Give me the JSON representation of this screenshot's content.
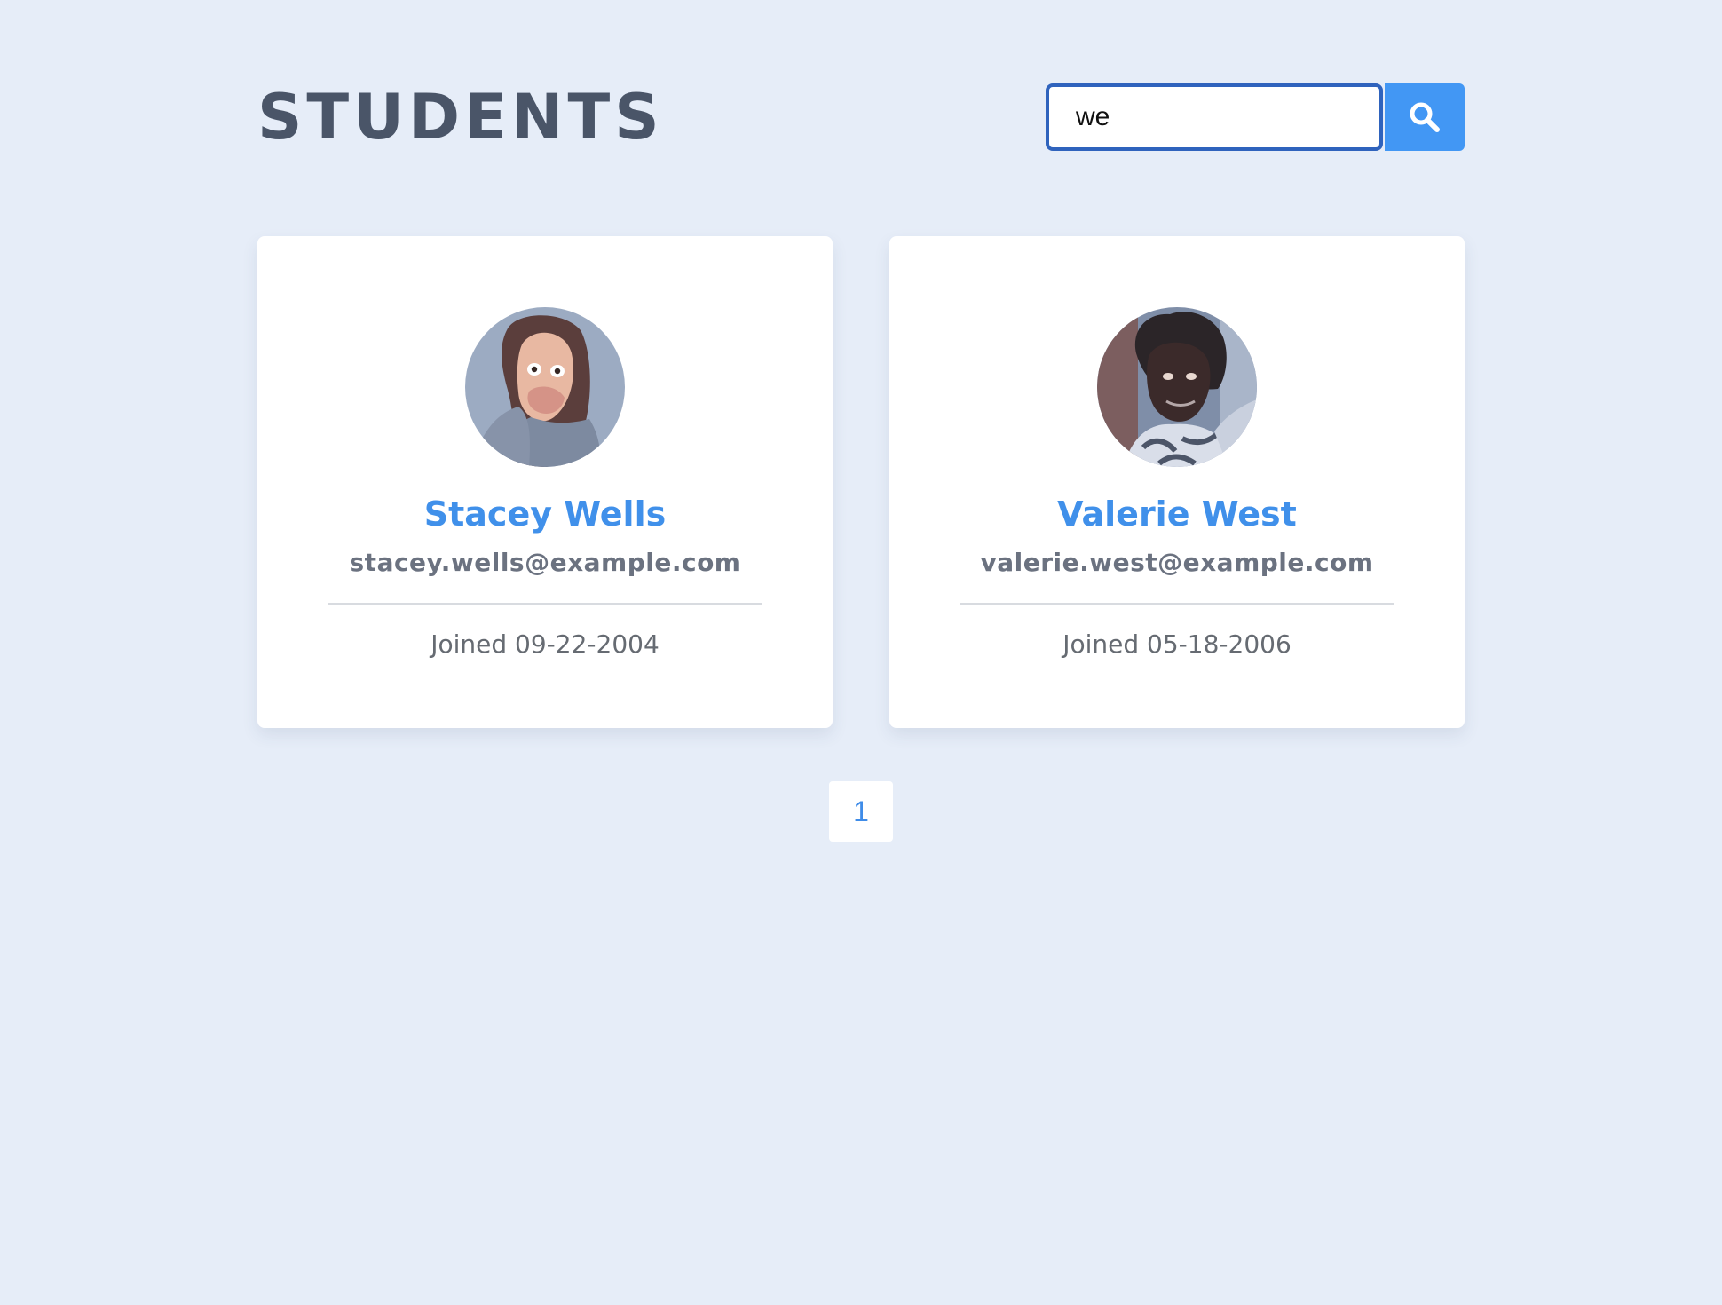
{
  "header": {
    "title": "STUDENTS"
  },
  "search": {
    "value": "we",
    "button_icon": "search-icon"
  },
  "students": [
    {
      "name": "Stacey Wells",
      "email": "stacey.wells@example.com",
      "joined": "Joined 09-22-2004"
    },
    {
      "name": "Valerie West",
      "email": "valerie.west@example.com",
      "joined": "Joined 05-18-2006"
    }
  ],
  "pagination": {
    "pages": [
      "1"
    ]
  },
  "colors": {
    "background": "#e6edf8",
    "title": "#4a5568",
    "accent": "#4297f4",
    "name": "#4090ea",
    "input_border": "#2f63bd"
  }
}
